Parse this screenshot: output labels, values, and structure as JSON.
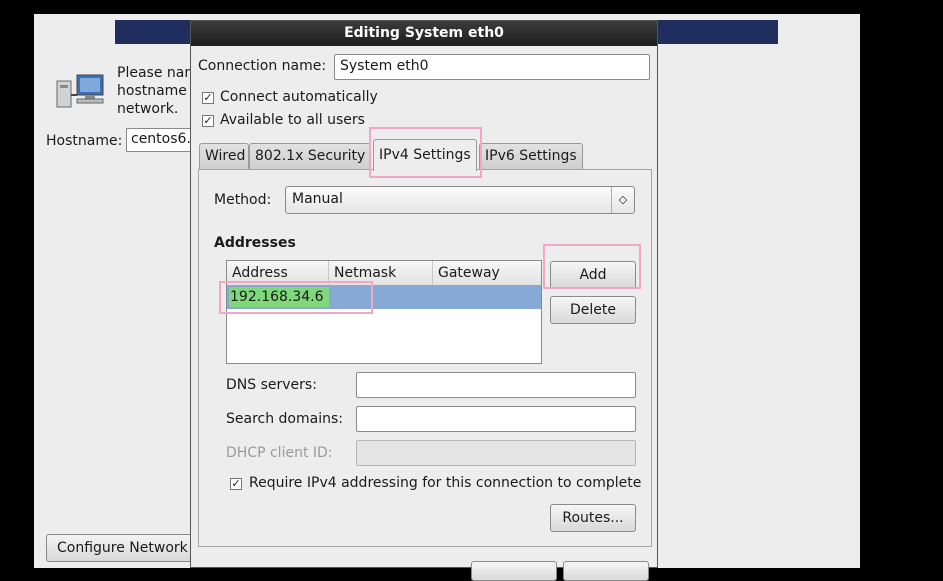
{
  "background": {
    "prompt_text": "Please nam\nhostname i\nnetwork.",
    "hostname_label": "Hostname:",
    "hostname_value": "centos6.",
    "configure_network_label": "Configure Network"
  },
  "dialog": {
    "title": "Editing System eth0",
    "connection_name_label": "Connection name:",
    "connection_name_value": "System eth0",
    "connect_automatically_label": "Connect automatically",
    "connect_automatically_checked": true,
    "available_all_users_label": "Available to all users",
    "available_all_users_checked": true,
    "tabs": [
      {
        "label": "Wired",
        "active": false
      },
      {
        "label": "802.1x Security",
        "active": false
      },
      {
        "label": "IPv4 Settings",
        "active": true
      },
      {
        "label": "IPv6 Settings",
        "active": false
      }
    ],
    "ipv4": {
      "method_label": "Method:",
      "method_value": "Manual",
      "addresses_heading": "Addresses",
      "columns": [
        "Address",
        "Netmask",
        "Gateway"
      ],
      "editing_address": "192.168.34.6",
      "add_label": "Add",
      "delete_label": "Delete",
      "dns_label": "DNS servers:",
      "dns_value": "",
      "search_domains_label": "Search domains:",
      "search_domains_value": "",
      "dhcp_client_id_label": "DHCP client ID:",
      "dhcp_client_id_value": "",
      "require_ipv4_label": "Require IPv4 addressing for this connection to complete",
      "require_ipv4_checked": true,
      "routes_label": "Routes..."
    }
  },
  "colors": {
    "highlight": "#f4a6c6",
    "selection_row": "#86a9d6",
    "edit_cell": "#7fd97a"
  }
}
